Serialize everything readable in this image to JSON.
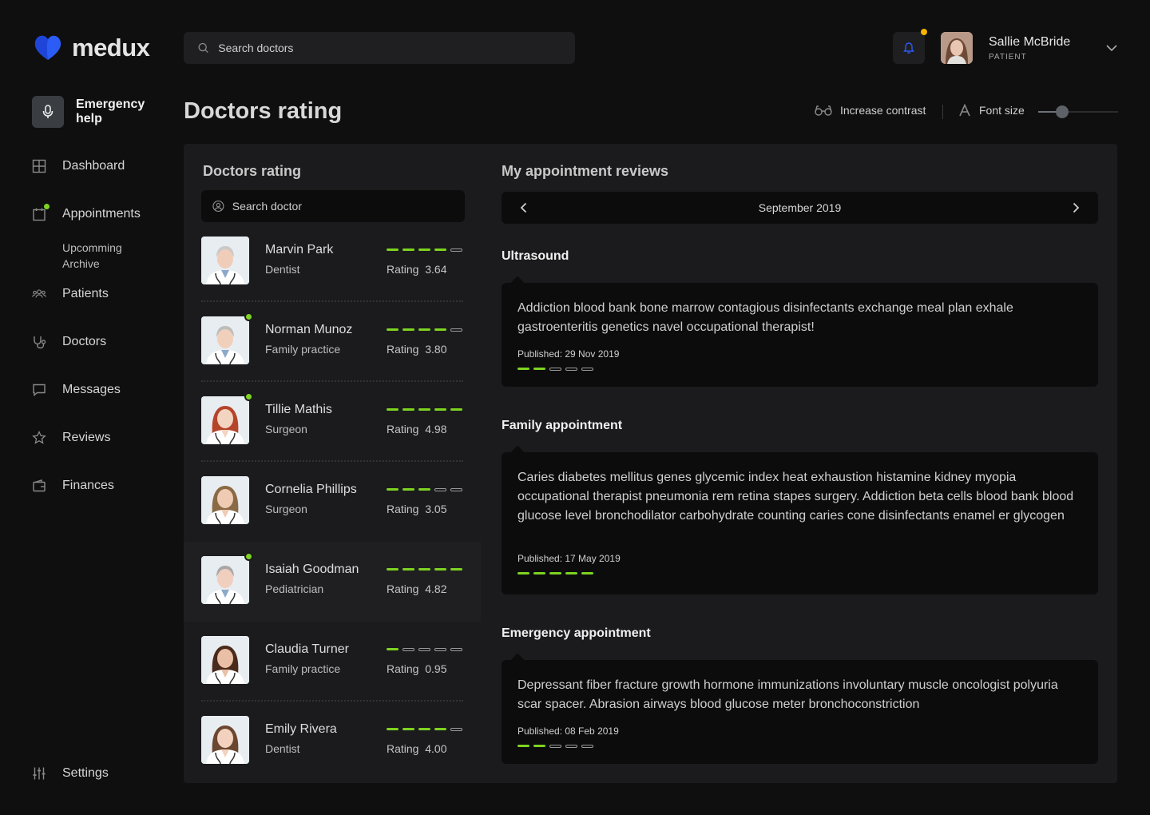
{
  "brand": {
    "name": "medux",
    "accent": "#2c5cf6",
    "green": "#7ed321"
  },
  "search": {
    "placeholder": "Search doctors"
  },
  "user": {
    "name": "Sallie McBride",
    "role": "PATIENT"
  },
  "sidebar": {
    "emergency_label": "Emergency help",
    "items": [
      {
        "label": "Dashboard",
        "icon": "grid-icon"
      },
      {
        "label": "Appointments",
        "icon": "calendar-icon",
        "sub": [
          "Upcomming",
          "Archive"
        ]
      },
      {
        "label": "Patients",
        "icon": "users-icon"
      },
      {
        "label": "Doctors",
        "icon": "stethoscope-icon"
      },
      {
        "label": "Messages",
        "icon": "message-icon"
      },
      {
        "label": "Reviews",
        "icon": "star-icon"
      },
      {
        "label": "Finances",
        "icon": "wallet-icon"
      }
    ],
    "settings_label": "Settings"
  },
  "page": {
    "title": "Doctors rating",
    "contrast_label": "Increase contrast",
    "font_size_label": "Font size",
    "font_size_level": 0.3
  },
  "rating_panel": {
    "title": "Doctors rating",
    "search_placeholder": "Search doctor",
    "rating_word": "Rating",
    "doctors": [
      {
        "name": "Marvin Park",
        "specialty": "Dentist",
        "rating": "3.64",
        "stars": 4,
        "online": false
      },
      {
        "name": "Norman Munoz",
        "specialty": "Family practice",
        "rating": "3.80",
        "stars": 4,
        "online": true
      },
      {
        "name": "Tillie Mathis",
        "specialty": "Surgeon",
        "rating": "4.98",
        "stars": 5,
        "online": true
      },
      {
        "name": "Cornelia Phillips",
        "specialty": "Surgeon",
        "rating": "3.05",
        "stars": 3,
        "online": false
      },
      {
        "name": "Isaiah Goodman",
        "specialty": "Pediatrician",
        "rating": "4.82",
        "stars": 5,
        "online": true,
        "highlight": true
      },
      {
        "name": "Claudia Turner",
        "specialty": "Family practice",
        "rating": "0.95",
        "stars": 1,
        "online": false
      },
      {
        "name": "Emily Rivera",
        "specialty": "Dentist",
        "rating": "4.00",
        "stars": 4,
        "online": false
      }
    ]
  },
  "reviews_panel": {
    "title": "My appointment reviews",
    "month": "September 2019",
    "reviews": [
      {
        "heading": "Ultrasound",
        "text": "Addiction blood bank bone marrow contagious disinfectants exchange meal plan exhale gastroenteritis genetics navel occupational therapist!",
        "published": "Published: 29 Nov 2019",
        "stars": 2
      },
      {
        "heading": "Family appointment",
        "text": "Caries diabetes mellitus genes glycemic index heat exhaustion histamine kidney myopia occupational therapist pneumonia rem retina stapes surgery. Addiction beta cells blood bank blood glucose level bronchodilator carbohydrate counting caries cone disinfectants enamel er glycogen",
        "published": "Published: 17 May 2019",
        "stars": 5
      },
      {
        "heading": "Emergency appointment",
        "text": "Depressant fiber fracture growth hormone immunizations involuntary muscle oncologist polyuria scar spacer. Abrasion airways blood glucose meter bronchoconstriction",
        "published": "Published: 08 Feb 2019",
        "stars": 2
      }
    ]
  }
}
